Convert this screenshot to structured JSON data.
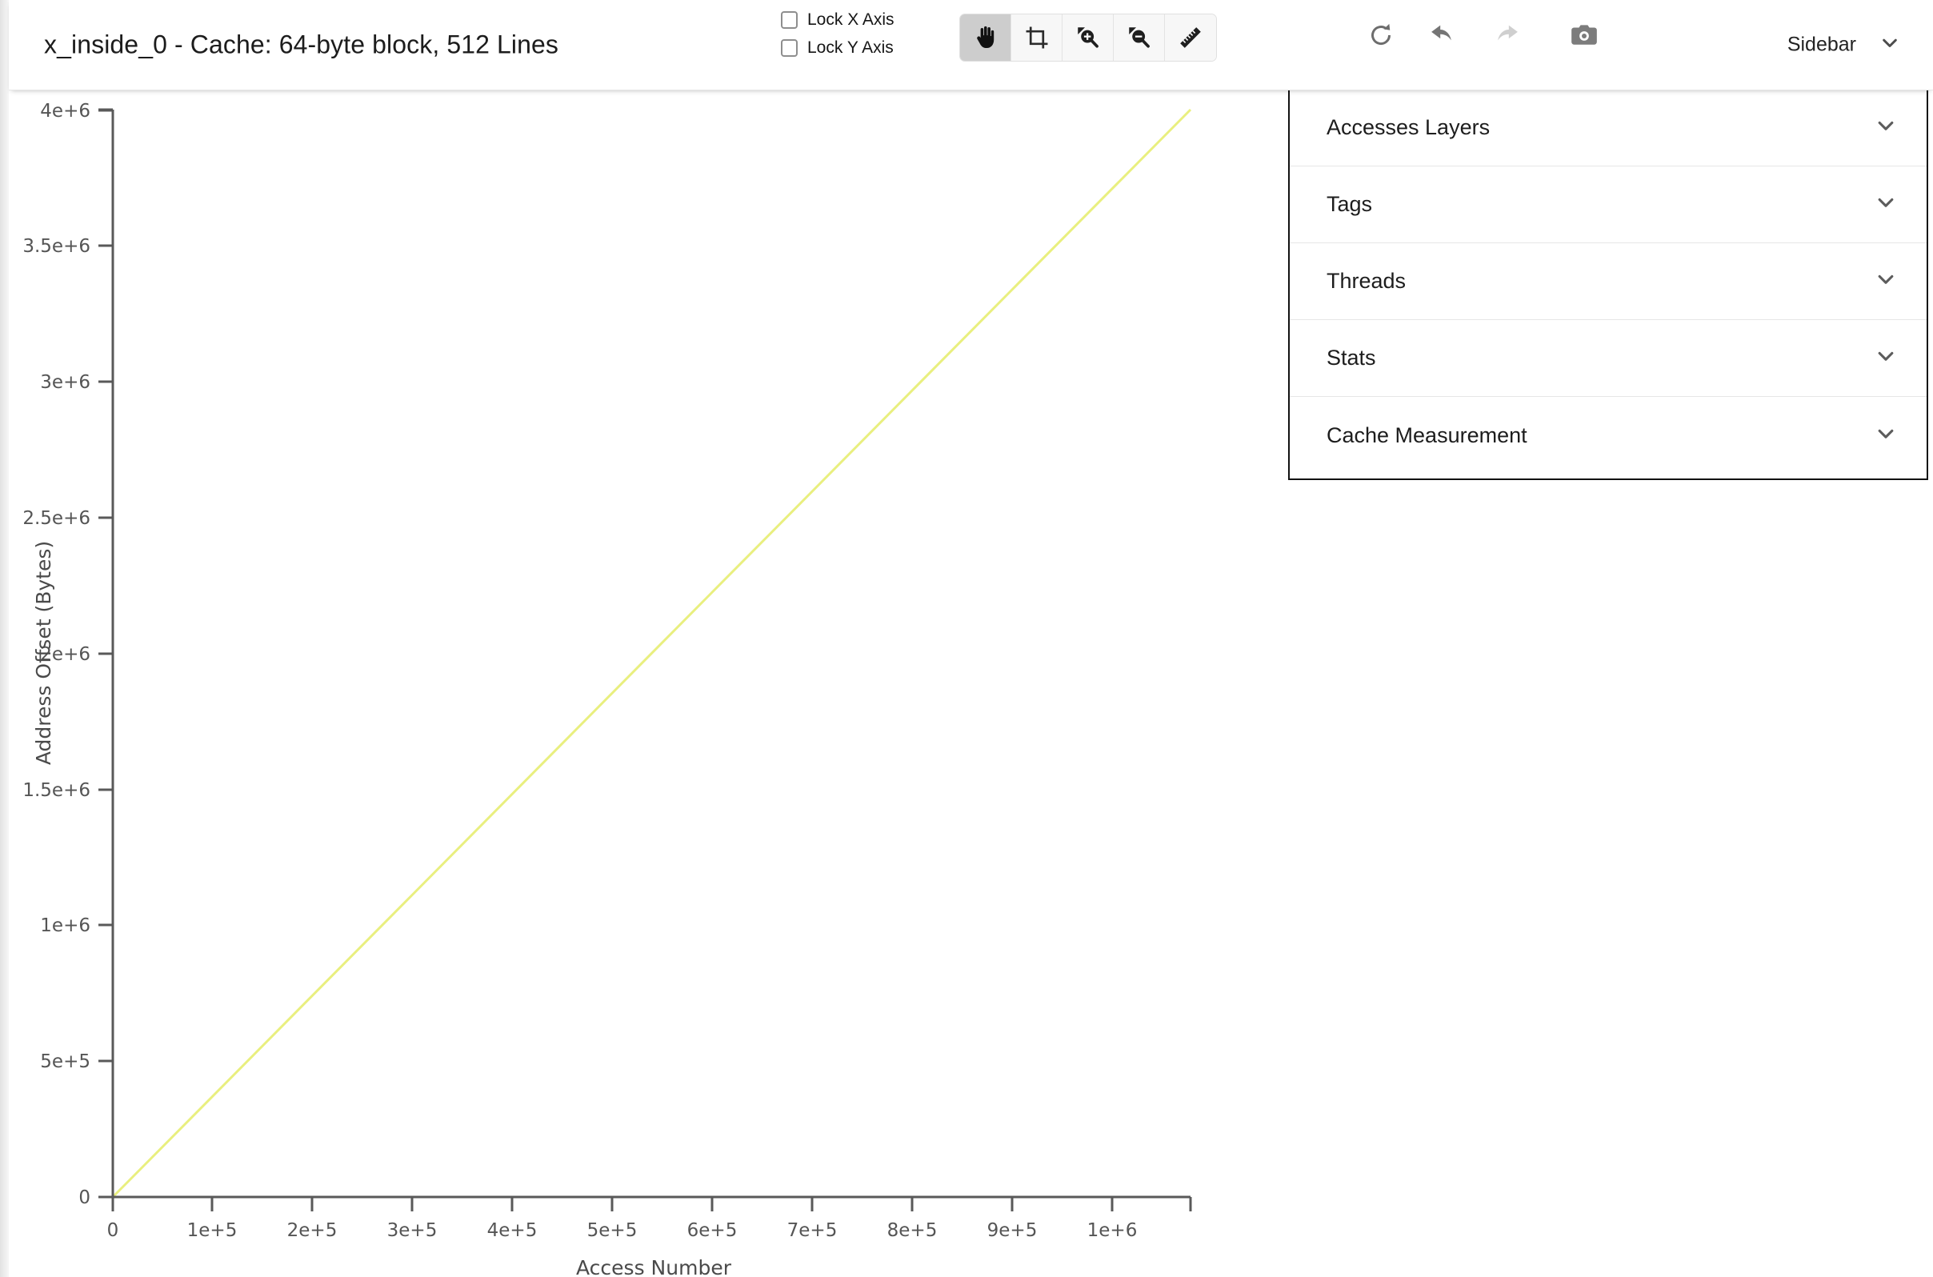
{
  "header": {
    "title": "x_inside_0 - Cache: 64-byte block, 512 Lines",
    "lock_x_label": "Lock X Axis",
    "lock_y_label": "Lock Y Axis",
    "lock_x_checked": false,
    "lock_y_checked": false,
    "sidebar_toggle_label": "Sidebar",
    "sidebar_chevron_icon": "chevron-down-icon"
  },
  "toolbar": {
    "tools": [
      {
        "name": "pan-tool",
        "icon": "hand-icon",
        "active": true
      },
      {
        "name": "crop-tool",
        "icon": "crop-icon",
        "active": false
      },
      {
        "name": "zoom-in-tool",
        "icon": "zoom-in-icon",
        "active": false
      },
      {
        "name": "zoom-out-tool",
        "icon": "zoom-out-icon",
        "active": false
      },
      {
        "name": "measure-tool",
        "icon": "ruler-icon",
        "active": false
      }
    ],
    "actions": [
      {
        "name": "refresh-button",
        "icon": "refresh-icon",
        "enabled": true
      },
      {
        "name": "undo-button",
        "icon": "undo-icon",
        "enabled": true
      },
      {
        "name": "redo-button",
        "icon": "redo-icon",
        "enabled": false
      },
      {
        "name": "screenshot-button",
        "icon": "camera-icon",
        "enabled": true
      }
    ]
  },
  "sidebar": {
    "sections": [
      {
        "label": "Accesses Layers",
        "expanded": false
      },
      {
        "label": "Tags",
        "expanded": false
      },
      {
        "label": "Threads",
        "expanded": false
      },
      {
        "label": "Stats",
        "expanded": false
      },
      {
        "label": "Cache Measurement",
        "expanded": false
      }
    ],
    "chevron_icon": "chevron-down-icon"
  },
  "colors": {
    "trace": "#e9ef7f",
    "axis": "#595959",
    "tick_text": "#555555",
    "panel_border": "#121212",
    "tool_active_bg": "#cdcdcd",
    "tool_bg": "#f7f7f7"
  },
  "chart_data": {
    "type": "line",
    "title": "x_inside_0 - Cache: 64-byte block, 512 Lines",
    "xlabel": "Access Number",
    "ylabel": "Address Offset (Bytes)",
    "xlim": [
      0,
      1080000
    ],
    "ylim": [
      0,
      4320000
    ],
    "grid": false,
    "legend": "none",
    "x_ticks": [
      0,
      100000,
      200000,
      300000,
      400000,
      500000,
      600000,
      700000,
      800000,
      900000,
      1000000
    ],
    "x_tick_labels": [
      "0",
      "1e+5",
      "2e+5",
      "3e+5",
      "4e+5",
      "5e+5",
      "6e+5",
      "7e+5",
      "8e+5",
      "9e+5",
      "1e+6"
    ],
    "y_ticks": [
      0,
      500000,
      1000000,
      1500000,
      2000000,
      2500000,
      3000000,
      3500000,
      4000000
    ],
    "y_tick_labels": [
      "0",
      "5e+5",
      "1e+6",
      "1.5e+6",
      "2e+6",
      "2.5e+6",
      "3e+6",
      "3.5e+6",
      "4e+6"
    ],
    "series": [
      {
        "name": "x_inside_0",
        "color": "#e9ef7f",
        "x": [
          0,
          100000,
          200000,
          300000,
          400000,
          500000,
          600000,
          700000,
          800000,
          900000,
          1000000,
          1080000
        ],
        "values": [
          0,
          400000,
          800000,
          1200000,
          1600000,
          2000000,
          2400000,
          2800000,
          3200000,
          3600000,
          4000000,
          4320000
        ]
      }
    ]
  }
}
